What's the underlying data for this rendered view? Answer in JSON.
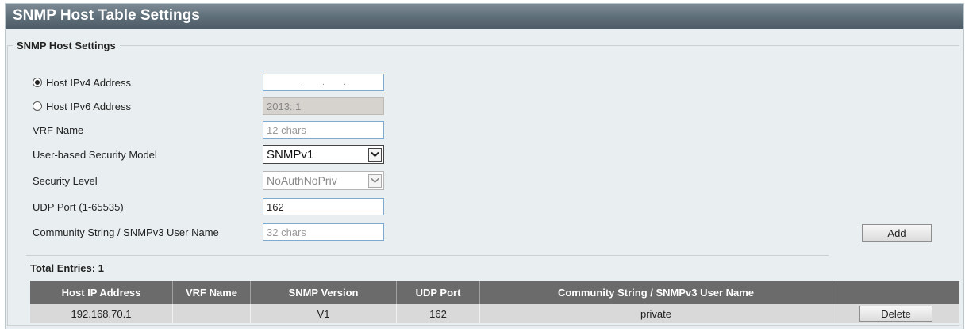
{
  "title": "SNMP Host Table Settings",
  "settings": {
    "legend": "SNMP Host Settings",
    "host_ipv4": {
      "label": "Host IPv4 Address",
      "selected": true,
      "separators": [
        ".",
        ".",
        "."
      ]
    },
    "host_ipv6": {
      "label": "Host IPv6 Address",
      "selected": false,
      "value": "2013::1"
    },
    "vrf_name": {
      "label": "VRF Name",
      "placeholder": "12 chars"
    },
    "security_model": {
      "label": "User-based Security Model",
      "value": "SNMPv1"
    },
    "security_level": {
      "label": "Security Level",
      "value": "NoAuthNoPriv"
    },
    "udp_port": {
      "label": "UDP Port (1-65535)",
      "value": "162"
    },
    "community": {
      "label": "Community String / SNMPv3 User Name",
      "placeholder": "32 chars"
    },
    "add_button": "Add"
  },
  "table": {
    "total_entries": "Total Entries: 1",
    "columns": [
      "Host IP Address",
      "VRF Name",
      "SNMP Version",
      "UDP Port",
      "Community String / SNMPv3 User Name",
      ""
    ],
    "rows": [
      {
        "host_ip": "192.168.70.1",
        "vrf": "",
        "version": "V1",
        "udp_port": "162",
        "community": "private",
        "action": "Delete"
      }
    ]
  },
  "icons": {
    "dropdown": "chevron-down-icon",
    "radio": "radio-icon"
  }
}
